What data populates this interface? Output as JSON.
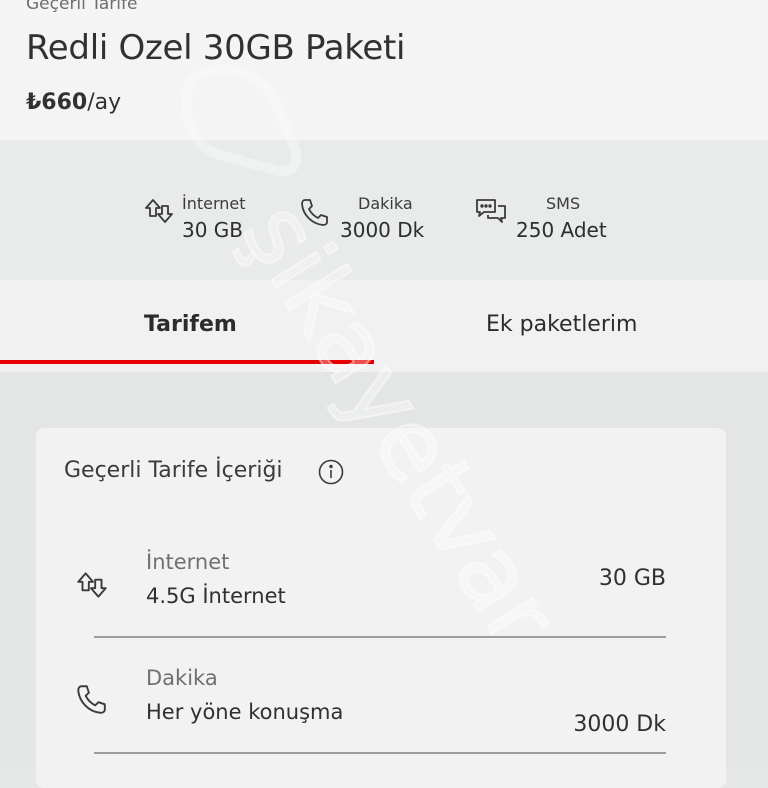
{
  "header": {
    "label": "Geçerli Tarife",
    "plan_name": "Redli Ozel 30GB Paketi",
    "price_amount": "₺660",
    "price_period": "/ay"
  },
  "summary": {
    "items": [
      {
        "title": "İnternet",
        "value": "30 GB",
        "icon": "data-arrows-icon"
      },
      {
        "title": "Dakika",
        "value": "3000 Dk",
        "icon": "phone-icon"
      },
      {
        "title": "SMS",
        "value": "250 Adet",
        "icon": "chat-bubbles-icon"
      }
    ]
  },
  "tabs": {
    "items": [
      {
        "label": "Tarifem",
        "active": true
      },
      {
        "label": "Ek paketlerim",
        "active": false
      }
    ],
    "accent_color": "#e60000"
  },
  "card": {
    "title": "Geçerli Tarife İçeriği",
    "info_icon": "info-icon",
    "rows": [
      {
        "title": "İnternet",
        "subtitle": "4.5G İnternet",
        "value": "30 GB",
        "icon": "data-arrows-icon"
      },
      {
        "title": "Dakika",
        "subtitle": "Her yöne konuşma",
        "value": "3000 Dk",
        "icon": "phone-icon"
      }
    ]
  },
  "watermark": {
    "text": "şikayetvar"
  }
}
